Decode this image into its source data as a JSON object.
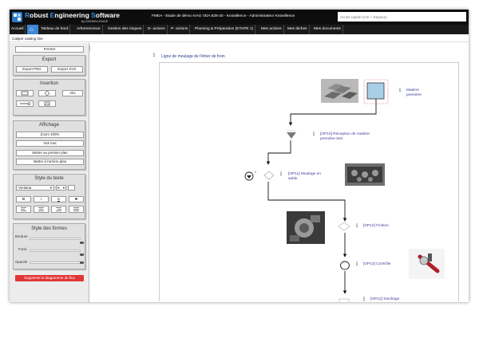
{
  "app": {
    "brand_parts": [
      {
        "cap": "R",
        "rest": "obust "
      },
      {
        "cap": "E",
        "rest": "ngineering "
      },
      {
        "cap": "S",
        "rest": "oftware"
      }
    ],
    "brand_sub": "by KNOWLLENCE",
    "context": "FMEA - Etude de démo AIAG VDA 828-20 - Knowllence - Administrateur Knowllence",
    "quick_search_placeholder": "Accès rapide (Ctrl + Espace)"
  },
  "nav": {
    "items": [
      {
        "label": "Accueil"
      },
      {
        "label": "Tableau de bord"
      },
      {
        "label": "Arborescence"
      },
      {
        "label": "Gestion des risques"
      },
      {
        "label": "D- actions"
      },
      {
        "label": "P- actions"
      },
      {
        "label": "Planning & Préparation (ETAPE 1)"
      },
      {
        "label": "Mes actions"
      },
      {
        "label": "Mes tâches"
      },
      {
        "label": "Mes documents"
      }
    ]
  },
  "breadcrumb": "Caliper casting line",
  "sidebar": {
    "close_label": "Fermer",
    "export": {
      "title": "Export",
      "png": "Export PNG",
      "svg": "Export SVG"
    },
    "insertion": {
      "title": "Insertion",
      "text_tool": "Abc"
    },
    "display": {
      "title": "Affichage",
      "zoom": "Zoom 100%",
      "see_all": "Voir tout",
      "bring_front": "Mettre au premier plan",
      "send_back": "Mettre à l'arrière plan"
    },
    "text_style": {
      "title": "Style du texte",
      "font": "Verdana",
      "size": "8"
    },
    "shape_style": {
      "title": "Style des formes",
      "border": "Bordure",
      "fill": "Fond",
      "opacity": "Opacité"
    },
    "delete_label": "Supprimer le diagramme de flux"
  },
  "diagram": {
    "title": "Ligne de moulage de l'étrier de frein",
    "steps": {
      "raw_material": "Matière première",
      "op10": "[OP10] Réception de matière première test",
      "op11": "[OP11] Moulage en sable",
      "op12_finish": "[OP12] Finition",
      "op13": "[OP13] Contrôle",
      "op12_storage": "[OP12] Stockage"
    }
  },
  "colors": {
    "topbar": "#0d0d0d",
    "nav_active": "#3d88d6",
    "brand_accent": "#3a8fe6",
    "step_text": "#3c3c9a",
    "delete_button": "#e23636"
  }
}
